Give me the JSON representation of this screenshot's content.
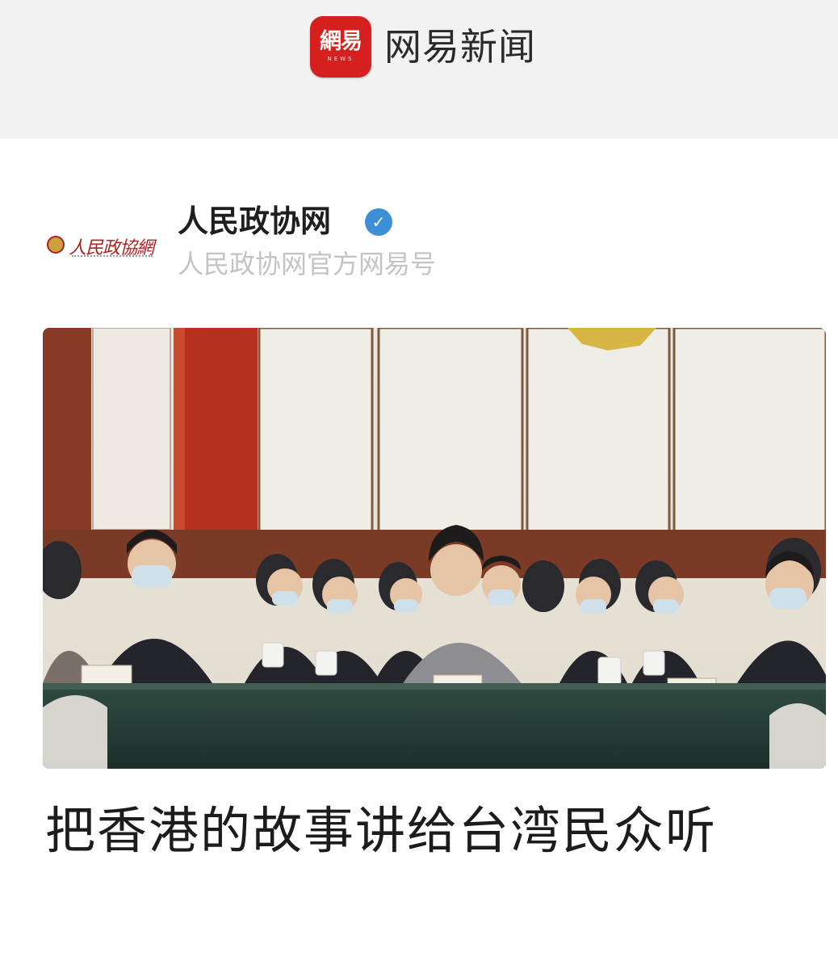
{
  "app": {
    "logo_text": "網易",
    "logo_subtext": "NEWS",
    "name": "网易新闻"
  },
  "publisher": {
    "logo_text": "人民政協網",
    "name": "人民政协网",
    "verified_icon": "verified-check-icon",
    "subtitle": "人民政协网官方网易号"
  },
  "article": {
    "image_alt": "会议现场照片",
    "headline": "把香港的故事讲给台湾民众听"
  },
  "colors": {
    "brand_red": "#d62020",
    "verified_blue": "#3d8fd6",
    "subtitle_gray": "#c4c4c4"
  }
}
